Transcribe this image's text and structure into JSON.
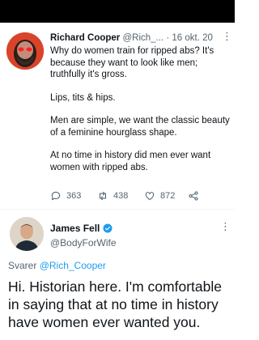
{
  "tweet1": {
    "author_name": "Richard Cooper",
    "handle_truncated": "@Rich_...",
    "separator": "·",
    "date": "16 okt. 20",
    "paragraphs": [
      "Why do women train for ripped abs?  It's because they want to look like men; truthfully it's gross.",
      "Lips, tits & hips.",
      "Men are simple, we want the classic beauty of a feminine hourglass shape.",
      "At no time in history did men ever want women with ripped abs."
    ],
    "replies": "363",
    "retweets": "438",
    "likes": "872"
  },
  "tweet2": {
    "author_name": "James Fell",
    "handle": "@BodyForWife",
    "reply_prefix": "Svarer",
    "reply_to": "@Rich_Cooper",
    "text": "Hi. Historian here. I'm comfortable in saying that at no time in history have women ever wanted you."
  },
  "colors": {
    "text": "#0f1419",
    "secondary": "#536471",
    "link": "#1d9bf0",
    "top_bar": "#000000"
  },
  "icons": [
    "avatar",
    "reply-icon",
    "retweet-icon",
    "like-icon",
    "share-icon",
    "verified-badge-icon",
    "more-icon"
  ]
}
